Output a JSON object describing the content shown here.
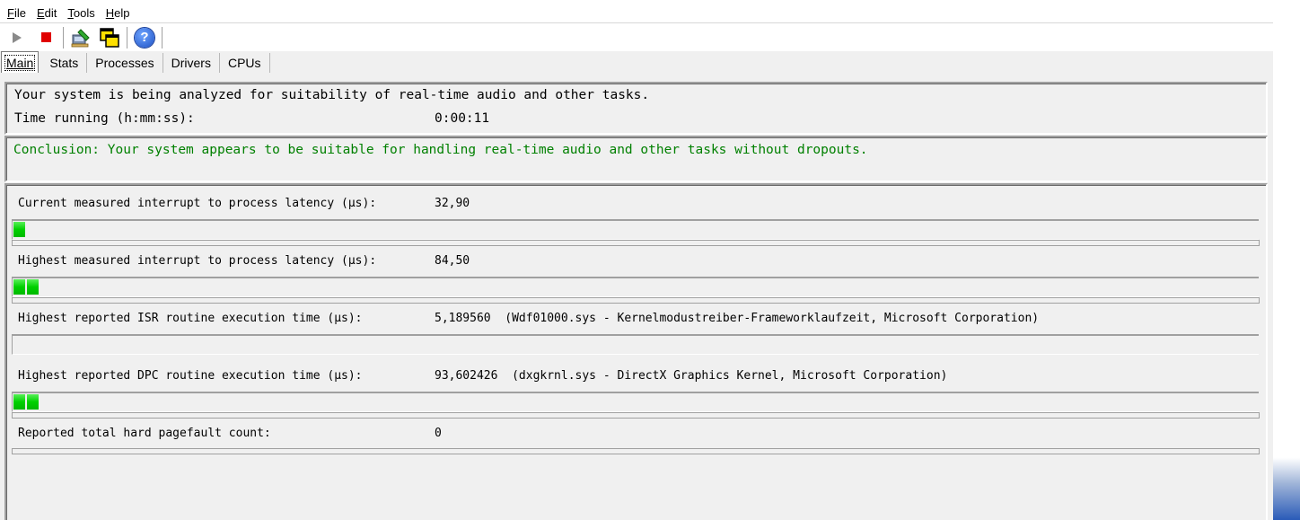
{
  "menu": {
    "items": [
      "File",
      "Edit",
      "Tools",
      "Help"
    ],
    "mnemonics": [
      "F",
      "E",
      "T",
      "H"
    ]
  },
  "toolbar": {
    "buttons": [
      "play-icon",
      "stop-icon",
      "settings-icon",
      "window-icon",
      "help-icon"
    ],
    "help_glyph": "?"
  },
  "tabs": [
    "Main",
    "Stats",
    "Processes",
    "Drivers",
    "CPUs"
  ],
  "status": {
    "analyzing": "Your system is being analyzed for suitability of real-time audio and other tasks.",
    "time_label": "Time running (h:mm:ss):",
    "time_value": "0:00:11",
    "conclusion": "Conclusion: Your system appears to be suitable for handling real-time audio and other tasks without dropouts.",
    "conclusion_color": "#008000"
  },
  "metrics": [
    {
      "label": "Current measured interrupt to process latency (µs):",
      "value": "32,90",
      "bar_segments": 1
    },
    {
      "label": "Highest measured interrupt to process latency (µs):",
      "value": "84,50",
      "bar_segments": 2
    },
    {
      "label": "Highest reported ISR routine execution time (µs):",
      "value": "5,189560  (Wdf01000.sys - Kernelmodustreiber-Frameworklaufzeit, Microsoft Corporation)",
      "bar_segments": 0
    },
    {
      "label": "Highest reported DPC routine execution time (µs):",
      "value": "93,602426  (dxgkrnl.sys - DirectX Graphics Kernel, Microsoft Corporation)",
      "bar_segments": 2
    },
    {
      "label": "Reported total hard pagefault count:",
      "value": "0",
      "bar_segments": 0
    }
  ],
  "colors": {
    "bar_fill": "#00d000",
    "window_bg": "#f0f0f0"
  }
}
